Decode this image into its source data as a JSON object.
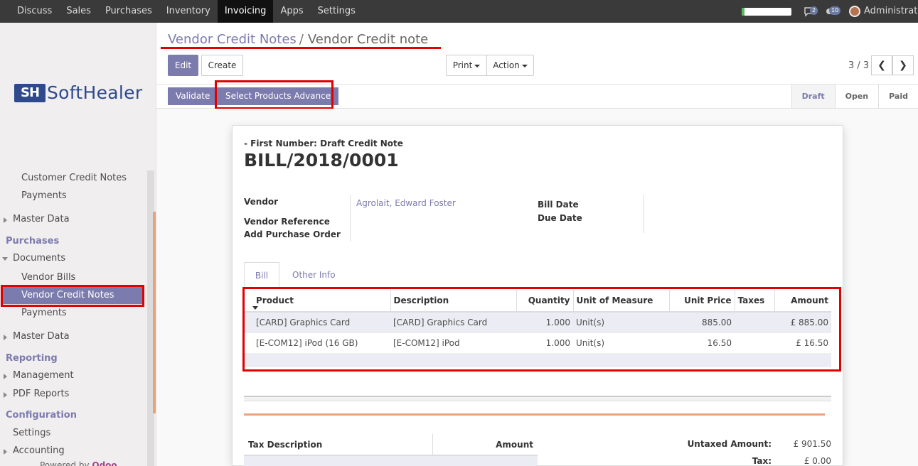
{
  "topbar": {
    "menu": [
      "Discuss",
      "Sales",
      "Purchases",
      "Inventory",
      "Invoicing",
      "Apps",
      "Settings"
    ],
    "active_menu": "Invoicing",
    "progress_level": 0.05,
    "progress_color": "#5cb85c",
    "messages_count": "2",
    "activities_count": "10",
    "user_name": "Administrator"
  },
  "sidebar": {
    "logo": {
      "mark": "SH",
      "text": "SoftHealer"
    },
    "items": [
      {
        "label": "Customer Credit Notes"
      },
      {
        "label": "Payments"
      },
      {
        "label": "Master Data"
      },
      {
        "label": "Purchases"
      },
      {
        "label": "Documents"
      },
      {
        "label": "Vendor Bills"
      },
      {
        "label": "Vendor Credit Notes"
      },
      {
        "label": "Payments"
      },
      {
        "label": "Master Data"
      },
      {
        "label": "Reporting"
      },
      {
        "label": "Management"
      },
      {
        "label": "PDF Reports"
      },
      {
        "label": "Configuration"
      },
      {
        "label": "Settings"
      },
      {
        "label": "Accounting"
      }
    ],
    "powered_by": "Powered by",
    "powered_brand": "Odoo"
  },
  "breadcrumb": {
    "parent": "Vendor Credit Notes",
    "separator": "/",
    "current": "Vendor Credit note"
  },
  "buttons": {
    "edit": "Edit",
    "create": "Create",
    "print": "Print",
    "action": "Action",
    "validate": "Validate",
    "select_products": "Select Products Advance"
  },
  "pager": {
    "text": "3 / 3",
    "prev": "❮",
    "next": "❯"
  },
  "status_stages": [
    {
      "label": "Draft",
      "active": true
    },
    {
      "label": "Open",
      "active": false
    },
    {
      "label": "Paid",
      "active": false
    }
  ],
  "form": {
    "subtitle": "- First Number: Draft Credit Note",
    "title": "BILL/2018/0001",
    "labels": {
      "vendor": "Vendor",
      "vendor_reference": "Vendor Reference",
      "add_purchase_order": "Add Purchase Order",
      "bill_date": "Bill Date",
      "due_date": "Due Date"
    },
    "vendor_value": "Agrolait, Edward Foster",
    "tabs": [
      "Bill",
      "Other Info"
    ]
  },
  "lines_table": {
    "headers": [
      "Product",
      "Description",
      "Quantity",
      "Unit of Measure",
      "Unit Price",
      "Taxes",
      "Amount"
    ],
    "rows": [
      [
        "[CARD] Graphics Card",
        "[CARD] Graphics Card",
        "1.000",
        "Unit(s)",
        "885.00",
        "",
        "£ 885.00"
      ],
      [
        "[E-COM12] iPod (16 GB)",
        "[E-COM12] iPod",
        "1.000",
        "Unit(s)",
        "16.50",
        "",
        "£ 16.50"
      ]
    ]
  },
  "tax_table": {
    "headers": [
      "Tax Description",
      "Amount"
    ]
  },
  "totals": {
    "untaxed_label": "Untaxed Amount:",
    "untaxed_value": "£ 901.50",
    "tax_label": "Tax:",
    "tax_value": "£ 0.00"
  },
  "colors": {
    "accent": "#7c7bad",
    "highlight": "#e00000",
    "stage_orange": "#e8a37c"
  }
}
